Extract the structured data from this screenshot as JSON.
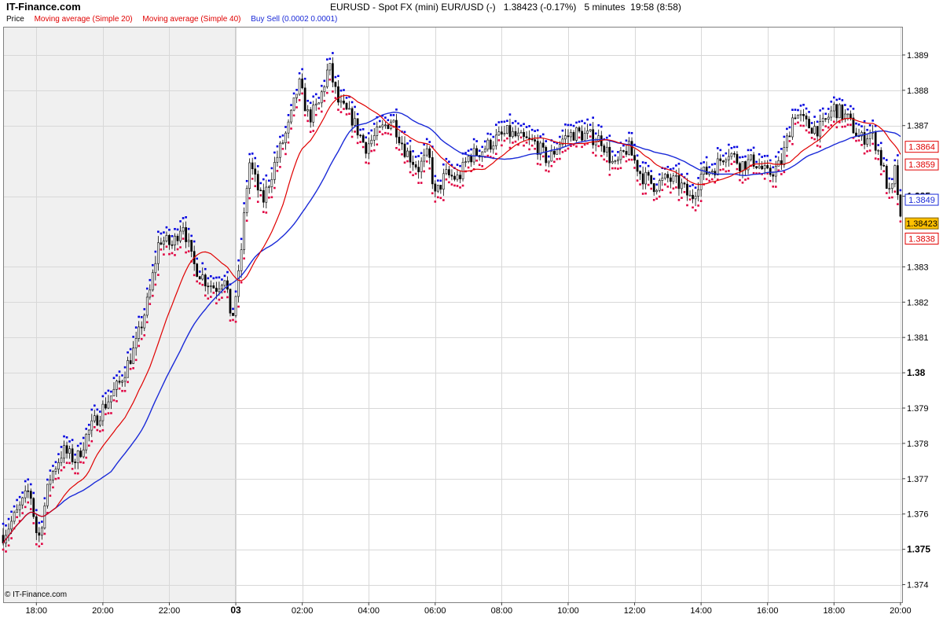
{
  "header": {
    "brand": "IT-Finance.com",
    "title": "EURUSD - Spot FX (mini) EUR/USD (-)",
    "last_price": "1.38423 (-0.17%)",
    "interval": "5 minutes",
    "time": "19:58 (8:58)"
  },
  "legend": {
    "price": "Price",
    "ma20": "Moving average (Simple 20)",
    "ma40": "Moving average (Simple 40)",
    "buysell": "Buy Sell (0.0002 0.0001)"
  },
  "copyright": "© IT-Finance.com",
  "colors": {
    "ma20": "#e00000",
    "ma40": "#1a2ad8",
    "buy_dot": "#0000e0",
    "sell_dot": "#e00040",
    "candle_up": "#ffffff",
    "candle_down": "#000000",
    "shaded_session": "#f0f0f0",
    "grid": "#d8d8d8",
    "last_price_badge": "#ffc000"
  },
  "chart_data": {
    "type": "candlestick",
    "ylim": [
      1.3735,
      1.3898
    ],
    "y_ticks": [
      {
        "value": 1.374,
        "label": "1.374"
      },
      {
        "value": 1.375,
        "label": "1.375",
        "bold": true
      },
      {
        "value": 1.376,
        "label": "1.376"
      },
      {
        "value": 1.377,
        "label": "1.377"
      },
      {
        "value": 1.378,
        "label": "1.378"
      },
      {
        "value": 1.379,
        "label": "1.379"
      },
      {
        "value": 1.38,
        "label": "1.38",
        "bold": true
      },
      {
        "value": 1.381,
        "label": "1.381"
      },
      {
        "value": 1.382,
        "label": "1.382"
      },
      {
        "value": 1.383,
        "label": "1.383"
      },
      {
        "value": 1.385,
        "label": "1.385",
        "bold": true
      },
      {
        "value": 1.387,
        "label": "1.387"
      },
      {
        "value": 1.388,
        "label": "1.388"
      },
      {
        "value": 1.389,
        "label": "1.389"
      }
    ],
    "x_ticks": [
      {
        "hour": -6,
        "label": "18:00"
      },
      {
        "hour": -4,
        "label": "20:00"
      },
      {
        "hour": -2,
        "label": "22:00"
      },
      {
        "hour": 0,
        "label": "03",
        "bold": true
      },
      {
        "hour": 2,
        "label": "02:00"
      },
      {
        "hour": 4,
        "label": "04:00"
      },
      {
        "hour": 6,
        "label": "06:00"
      },
      {
        "hour": 8,
        "label": "08:00"
      },
      {
        "hour": 10,
        "label": "10:00"
      },
      {
        "hour": 12,
        "label": "12:00"
      },
      {
        "hour": 14,
        "label": "14:00"
      },
      {
        "hour": 16,
        "label": "16:00"
      },
      {
        "hour": 18,
        "label": "18:00"
      },
      {
        "hour": 20,
        "label": "20:00"
      }
    ],
    "x_range_hours": [
      -7.0,
      20.05
    ],
    "shaded_until_hour": 0,
    "close_path": [
      [
        -7.0,
        1.3754
      ],
      [
        -6.6,
        1.376
      ],
      [
        -6.2,
        1.3767
      ],
      [
        -5.95,
        1.3752
      ],
      [
        -5.6,
        1.377
      ],
      [
        -5.2,
        1.3778
      ],
      [
        -4.8,
        1.3775
      ],
      [
        -4.5,
        1.3782
      ],
      [
        -4.0,
        1.379
      ],
      [
        -3.5,
        1.3797
      ],
      [
        -3.0,
        1.3808
      ],
      [
        -2.6,
        1.3822
      ],
      [
        -2.3,
        1.3838
      ],
      [
        -1.9,
        1.3836
      ],
      [
        -1.6,
        1.3843
      ],
      [
        -1.3,
        1.3831
      ],
      [
        -0.9,
        1.3826
      ],
      [
        -0.6,
        1.3824
      ],
      [
        -0.3,
        1.3828
      ],
      [
        -0.15,
        1.3813
      ],
      [
        0.1,
        1.3828
      ],
      [
        0.4,
        1.386
      ],
      [
        0.8,
        1.3848
      ],
      [
        1.2,
        1.386
      ],
      [
        1.6,
        1.387
      ],
      [
        1.9,
        1.3882
      ],
      [
        2.2,
        1.3872
      ],
      [
        2.5,
        1.3876
      ],
      [
        2.8,
        1.3887
      ],
      [
        3.1,
        1.3876
      ],
      [
        3.5,
        1.3872
      ],
      [
        3.9,
        1.3864
      ],
      [
        4.3,
        1.3868
      ],
      [
        4.7,
        1.3872
      ],
      [
        5.1,
        1.3863
      ],
      [
        5.5,
        1.3858
      ],
      [
        5.8,
        1.3862
      ],
      [
        6.0,
        1.385
      ],
      [
        6.3,
        1.3856
      ],
      [
        6.7,
        1.3855
      ],
      [
        7.0,
        1.3861
      ],
      [
        7.4,
        1.3863
      ],
      [
        7.8,
        1.3866
      ],
      [
        8.2,
        1.3868
      ],
      [
        8.6,
        1.3866
      ],
      [
        9.0,
        1.3865
      ],
      [
        9.4,
        1.386
      ],
      [
        9.8,
        1.3866
      ],
      [
        10.2,
        1.3868
      ],
      [
        10.6,
        1.3867
      ],
      [
        11.0,
        1.3866
      ],
      [
        11.4,
        1.3858
      ],
      [
        11.8,
        1.3864
      ],
      [
        12.2,
        1.3856
      ],
      [
        12.6,
        1.3853
      ],
      [
        13.0,
        1.3855
      ],
      [
        13.4,
        1.3853
      ],
      [
        13.7,
        1.3849
      ],
      [
        14.0,
        1.3856
      ],
      [
        14.4,
        1.3858
      ],
      [
        14.8,
        1.3863
      ],
      [
        15.2,
        1.3859
      ],
      [
        15.6,
        1.386
      ],
      [
        16.0,
        1.3856
      ],
      [
        16.4,
        1.3859
      ],
      [
        16.8,
        1.3874
      ],
      [
        17.2,
        1.387
      ],
      [
        17.6,
        1.3869
      ],
      [
        18.0,
        1.3875
      ],
      [
        18.4,
        1.3872
      ],
      [
        18.8,
        1.3866
      ],
      [
        19.1,
        1.3868
      ],
      [
        19.3,
        1.3864
      ],
      [
        19.5,
        1.3857
      ],
      [
        19.7,
        1.3849
      ],
      [
        19.85,
        1.3858
      ],
      [
        20.0,
        1.38423
      ]
    ],
    "bar_minutes": 5,
    "price_labels": [
      {
        "value": 1.3864,
        "label": "1.3864",
        "color": "#e00000",
        "kind": "ma20"
      },
      {
        "value": 1.3859,
        "label": "1.3859",
        "color": "#e00000",
        "kind": "ma20"
      },
      {
        "value": 1.3849,
        "label": "1.3849",
        "color": "#1a2ad8",
        "kind": "ma40"
      },
      {
        "value": 1.38423,
        "label": "1.38423",
        "color": "#000000",
        "kind": "last"
      },
      {
        "value": 1.3838,
        "label": "1.3838",
        "color": "#e00000",
        "kind": "sell"
      }
    ],
    "series": [
      {
        "name": "Price"
      },
      {
        "name": "Moving average (Simple 20)"
      },
      {
        "name": "Moving average (Simple 40)"
      },
      {
        "name": "Buy Sell (0.0002 0.0001)"
      }
    ]
  }
}
